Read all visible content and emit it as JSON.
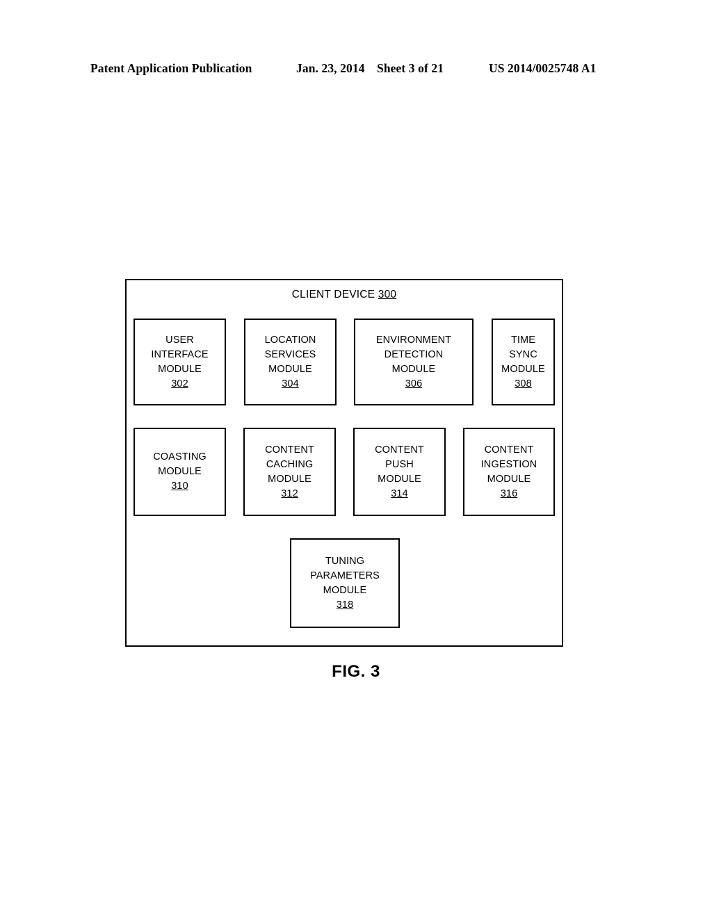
{
  "header": {
    "left": "Patent Application Publication",
    "date": "Jan. 23, 2014",
    "sheet": "Sheet 3 of 21",
    "patent_number": "US 2014/0025748 A1"
  },
  "figure": {
    "caption": "FIG. 3",
    "container": {
      "title": "CLIENT DEVICE",
      "ref": "300"
    },
    "modules": [
      {
        "label": "USER\nINTERFACE\nMODULE",
        "ref": "302"
      },
      {
        "label": "LOCATION\nSERVICES\nMODULE",
        "ref": "304"
      },
      {
        "label": "ENVIRONMENT\nDETECTION\nMODULE",
        "ref": "306"
      },
      {
        "label": "TIME\nSYNC\nMODULE",
        "ref": "308"
      },
      {
        "label": "COASTING\nMODULE",
        "ref": "310"
      },
      {
        "label": "CONTENT\nCACHING\nMODULE",
        "ref": "312"
      },
      {
        "label": "CONTENT\nPUSH\nMODULE",
        "ref": "314"
      },
      {
        "label": "CONTENT\nINGESTION\nMODULE",
        "ref": "316"
      },
      {
        "label": "TUNING\nPARAMETERS\nMODULE",
        "ref": "318"
      }
    ]
  }
}
